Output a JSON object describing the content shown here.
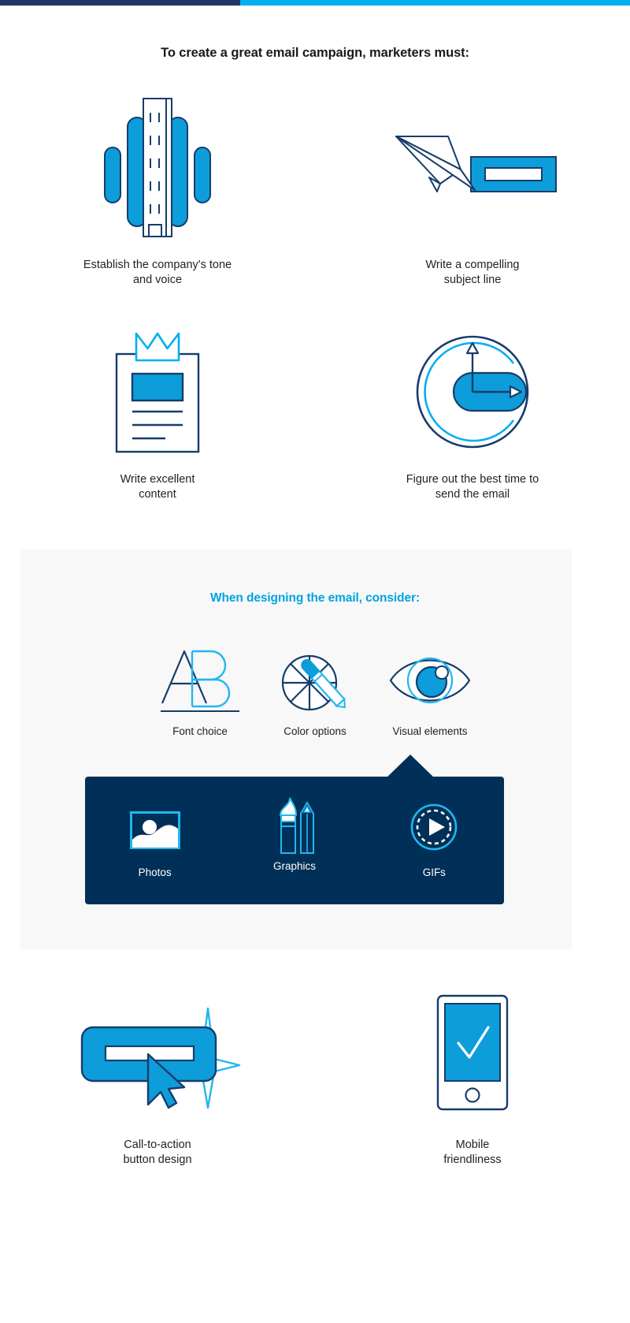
{
  "topbar": {
    "left_color": "#1f3864",
    "right_color": "#00b0f0"
  },
  "headline": "To create a great email campaign, marketers must:",
  "colors": {
    "navy": "#1f3864",
    "dark_navy_outline": "#173d6b",
    "bright_blue": "#0d9ddb",
    "cyan": "#00b0f0",
    "navy_box": "#003057",
    "gray_panel": "#f8f8f8",
    "text": "#231f20"
  },
  "steps": [
    {
      "icon": "voice-waveform-icon",
      "label": "Establish the company's tone\nand voice"
    },
    {
      "icon": "paper-plane-envelope-icon",
      "label": "Write a compelling\nsubject line"
    },
    {
      "icon": "clipboard-crown-icon",
      "label": "Write excellent\ncontent"
    },
    {
      "icon": "clock-icon",
      "label": "Figure out the best time to\nsend the email"
    }
  ],
  "design_section": {
    "title": "When designing the email, consider:",
    "items": [
      {
        "icon": "font-ab-icon",
        "label": "Font choice"
      },
      {
        "icon": "color-wheel-brush-icon",
        "label": "Color options"
      },
      {
        "icon": "eye-icon",
        "label": "Visual elements"
      }
    ],
    "visual_elements": [
      {
        "icon": "photo-icon",
        "label": "Photos"
      },
      {
        "icon": "brush-pencil-icon",
        "label": "Graphics"
      },
      {
        "icon": "play-gif-icon",
        "label": "GIFs"
      }
    ]
  },
  "bottom_steps": [
    {
      "icon": "cta-button-cursor-icon",
      "label": "Call-to-action\nbutton design"
    },
    {
      "icon": "mobile-check-icon",
      "label": "Mobile\nfriendliness"
    }
  ]
}
